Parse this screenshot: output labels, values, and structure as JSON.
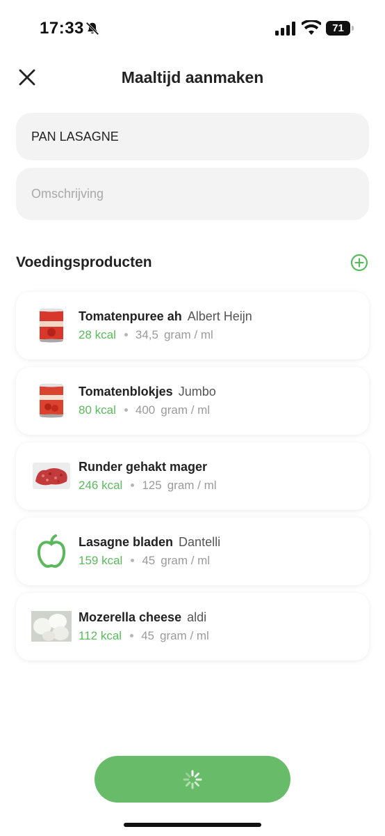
{
  "status_bar": {
    "time": "17:33",
    "battery": "71",
    "icons": [
      "bell-muted-icon",
      "signal-icon",
      "wifi-icon",
      "battery-icon"
    ]
  },
  "header": {
    "title": "Maaltijd aanmaken",
    "close_icon": "close-icon"
  },
  "form": {
    "name_value": "PAN LASAGNE",
    "description_value": "",
    "description_placeholder": "Omschrijving"
  },
  "section": {
    "title": "Voedingsproducten",
    "add_icon": "plus-circle-icon"
  },
  "products": [
    {
      "name": "Tomatenpuree ah",
      "brand": "Albert Heijn",
      "kcal": "28 kcal",
      "amount": "34,5",
      "unit": "gram / ml",
      "image": "tomato-puree-can"
    },
    {
      "name": "Tomatenblokjes",
      "brand": "Jumbo",
      "kcal": "80 kcal",
      "amount": "400",
      "unit": "gram / ml",
      "image": "tomato-blocks-can"
    },
    {
      "name": "Runder gehakt mager",
      "brand": "",
      "kcal": "246 kcal",
      "amount": "125",
      "unit": "gram / ml",
      "image": "ground-beef"
    },
    {
      "name": "Lasagne bladen",
      "brand": "Dantelli",
      "kcal": "159 kcal",
      "amount": "45",
      "unit": "gram / ml",
      "image": "apple-icon"
    },
    {
      "name": "Mozerella cheese",
      "brand": "aldi",
      "kcal": "112 kcal",
      "amount": "45",
      "unit": "gram / ml",
      "image": "mozzarella"
    }
  ],
  "save_button": {
    "state": "loading",
    "icon": "spinner-icon"
  },
  "colors": {
    "accent_green": "#68bb68",
    "kcal_green": "#5bb85d",
    "field_background": "#f3f3f3"
  }
}
